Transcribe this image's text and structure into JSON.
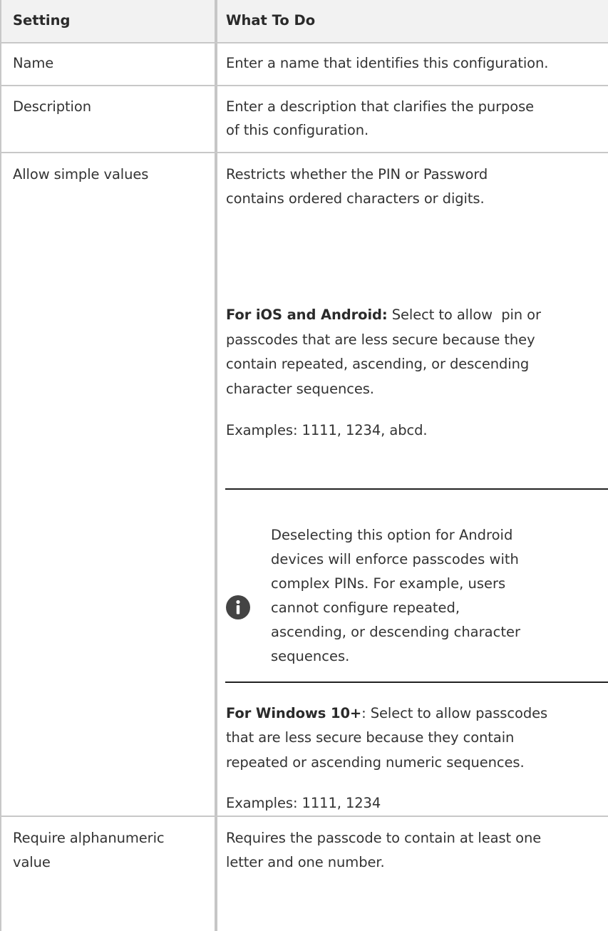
{
  "table": {
    "headers": [
      "Setting",
      "What To Do"
    ],
    "rows": [
      {
        "setting": "Name",
        "what": "Enter a name that identifies this configuration."
      },
      {
        "setting": "Description",
        "what_lines": [
          "Enter a description that clarifies the purpose",
          "of this configuration."
        ]
      },
      {
        "setting": "Allow simple values",
        "intro_lines": [
          "Restricts whether the PIN or Password",
          "contains ordered characters or digits."
        ],
        "ios_label": "For iOS and Android:",
        "ios_lines": [
          " Select to allow  pin or",
          "passcodes that are less secure because they",
          "contain repeated, ascending, or descending",
          "character sequences."
        ],
        "ios_examples": "Examples: 1111, 1234, abcd.",
        "note": {
          "icon": "info-icon",
          "lines": [
            "Deselecting this option for Android",
            "devices will enforce passcodes with",
            "complex PINs. For example, users",
            "cannot configure repeated,",
            "ascending, or descending character",
            "sequences."
          ]
        },
        "win_label": "For Windows 10+",
        "win_lines": [
          ": Select to allow passcodes",
          "that are less secure because they contain",
          "repeated or ascending numeric sequences."
        ],
        "win_examples": "Examples: 1111, 1234"
      },
      {
        "setting_lines": [
          "Require alphanumeric",
          "value"
        ],
        "what_lines": [
          "Requires the passcode to contain at least one",
          "letter and one number."
        ]
      }
    ]
  }
}
